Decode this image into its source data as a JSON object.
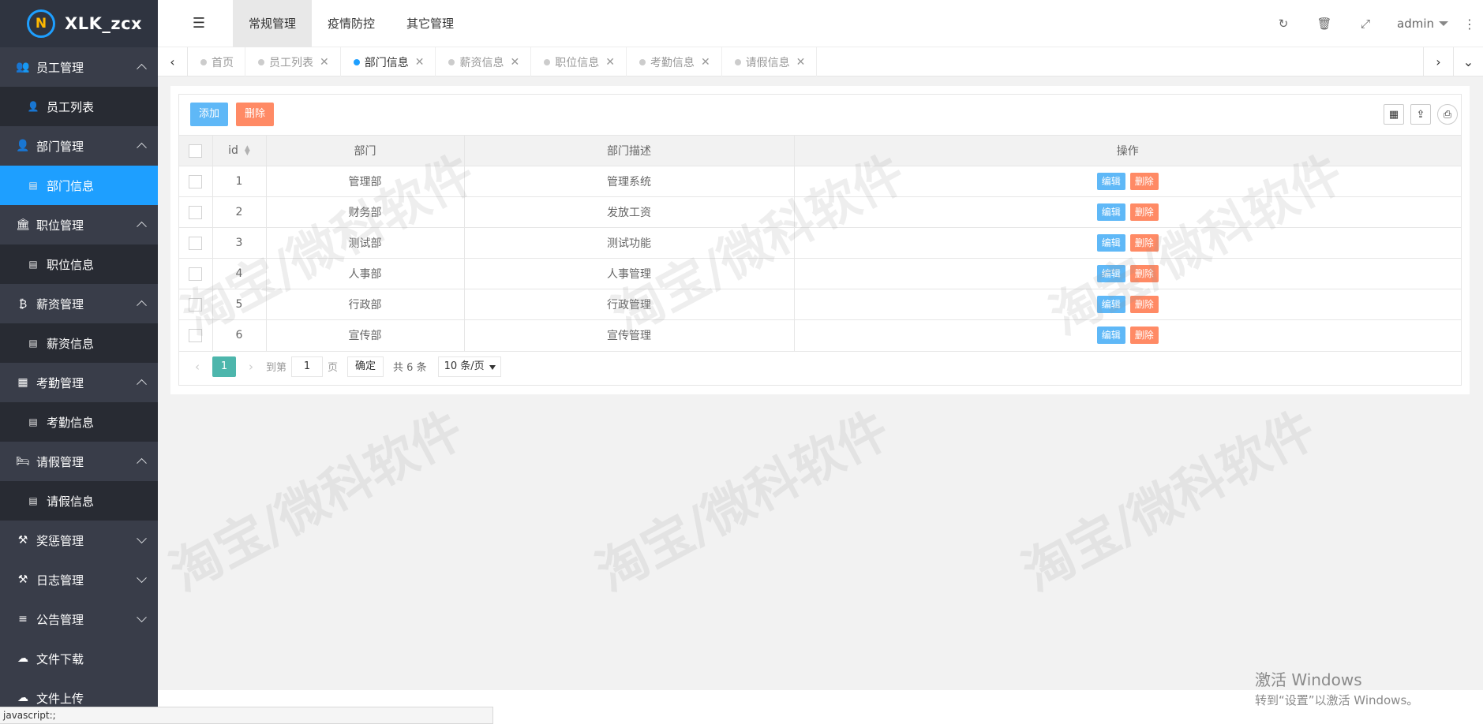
{
  "app": {
    "title": "XLK_zcx",
    "logo_mark": "N"
  },
  "sidebar": {
    "groups": [
      {
        "label": "员工管理",
        "icon": "users-icon",
        "expanded": true,
        "children": [
          {
            "label": "员工列表",
            "icon": "user-icon",
            "active": false
          }
        ]
      },
      {
        "label": "部门管理",
        "icon": "user-icon",
        "expanded": true,
        "children": [
          {
            "label": "部门信息",
            "icon": "list-icon",
            "active": true
          }
        ]
      },
      {
        "label": "职位管理",
        "icon": "bank-icon",
        "expanded": true,
        "children": [
          {
            "label": "职位信息",
            "icon": "list-icon",
            "active": false
          }
        ]
      },
      {
        "label": "薪资管理",
        "icon": "bitcoin-icon",
        "expanded": true,
        "children": [
          {
            "label": "薪资信息",
            "icon": "list-icon",
            "active": false
          }
        ]
      },
      {
        "label": "考勤管理",
        "icon": "calendar-icon",
        "expanded": true,
        "children": [
          {
            "label": "考勤信息",
            "icon": "list-icon",
            "active": false
          }
        ]
      },
      {
        "label": "请假管理",
        "icon": "bed-icon",
        "expanded": true,
        "children": [
          {
            "label": "请假信息",
            "icon": "list-icon",
            "active": false
          }
        ]
      },
      {
        "label": "奖惩管理",
        "icon": "gavel-icon",
        "expanded": false,
        "children": []
      },
      {
        "label": "日志管理",
        "icon": "gavel-icon",
        "expanded": false,
        "children": []
      },
      {
        "label": "公告管理",
        "icon": "menu-icon",
        "expanded": false,
        "children": []
      },
      {
        "label": "文件下载",
        "icon": "cloud-download-icon",
        "expanded": null,
        "children": []
      },
      {
        "label": "文件上传",
        "icon": "cloud-upload-icon",
        "expanded": null,
        "children": []
      }
    ]
  },
  "header": {
    "menu": [
      {
        "label": "常规管理",
        "active": true
      },
      {
        "label": "疫情防控",
        "active": false
      },
      {
        "label": "其它管理",
        "active": false
      }
    ],
    "user": "admin"
  },
  "tabs": [
    {
      "label": "首页",
      "active": false,
      "closable": false
    },
    {
      "label": "员工列表",
      "active": false,
      "closable": true
    },
    {
      "label": "部门信息",
      "active": true,
      "closable": true
    },
    {
      "label": "薪资信息",
      "active": false,
      "closable": true
    },
    {
      "label": "职位信息",
      "active": false,
      "closable": true
    },
    {
      "label": "考勤信息",
      "active": false,
      "closable": true
    },
    {
      "label": "请假信息",
      "active": false,
      "closable": true
    }
  ],
  "toolbar": {
    "add_label": "添加",
    "delete_label": "删除"
  },
  "table": {
    "columns": [
      "id",
      "部门",
      "部门描述",
      "操作"
    ],
    "rows": [
      {
        "id": "1",
        "name": "管理部",
        "desc": "管理系统"
      },
      {
        "id": "2",
        "name": "财务部",
        "desc": "发放工资"
      },
      {
        "id": "3",
        "name": "测试部",
        "desc": "测试功能"
      },
      {
        "id": "4",
        "name": "人事部",
        "desc": "人事管理"
      },
      {
        "id": "5",
        "name": "行政部",
        "desc": "行政管理"
      },
      {
        "id": "6",
        "name": "宣传部",
        "desc": "宣传管理"
      }
    ],
    "edit_label": "编辑",
    "remove_label": "删除"
  },
  "pager": {
    "current": "1",
    "goto_label": "到第",
    "goto_value": "1",
    "page_label": "页",
    "confirm_label": "确定",
    "total_label": "共 6 条",
    "page_size": "10 条/页"
  },
  "watermark": "淘宝/微科软件",
  "activation": {
    "line1": "激活 Windows",
    "line2": "转到“设置”以激活 Windows。"
  },
  "status_bar": "javascript:;"
}
